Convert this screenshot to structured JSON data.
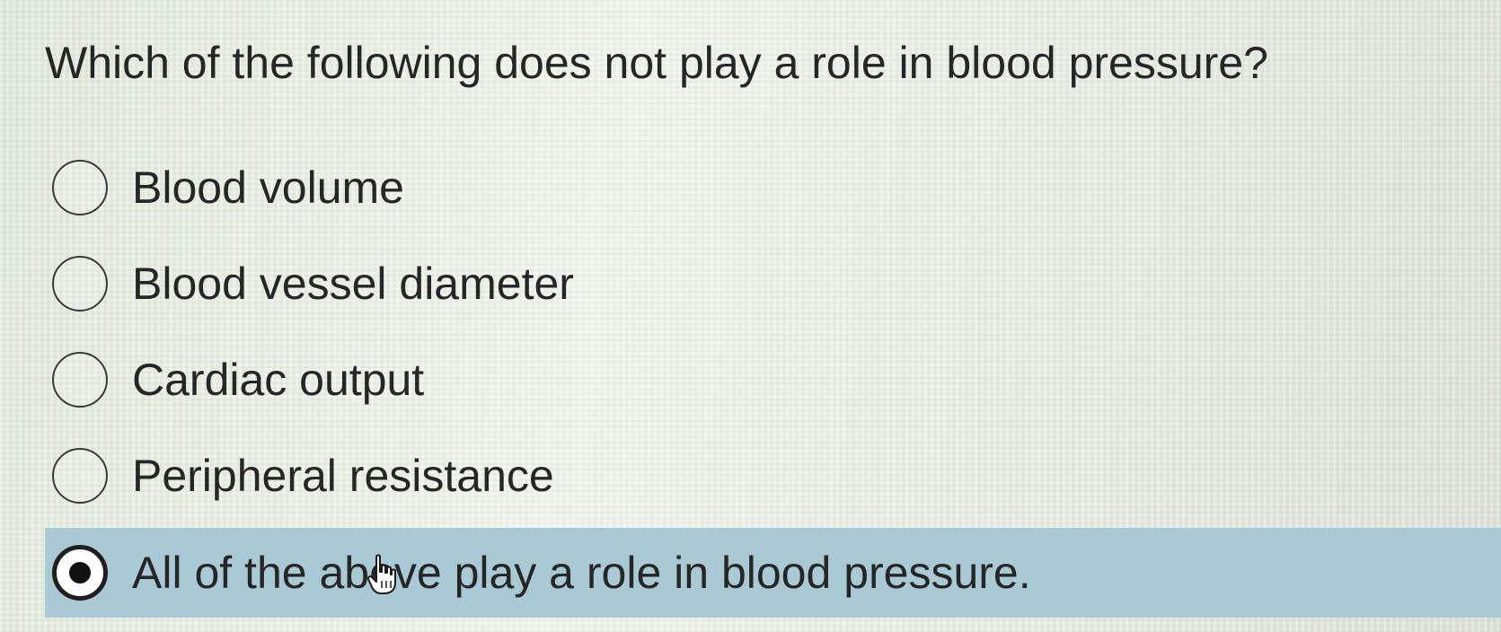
{
  "question": {
    "text": "Which of the following does not play a role in blood pressure?"
  },
  "options": [
    {
      "label": "Blood volume",
      "selected": false
    },
    {
      "label": "Blood vessel diameter",
      "selected": false
    },
    {
      "label": "Cardiac output",
      "selected": false
    },
    {
      "label": "Peripheral resistance",
      "selected": false
    },
    {
      "label": "All of the above play a role in blood pressure.",
      "selected": true
    }
  ],
  "cursor": {
    "icon": "hand-pointer-icon"
  },
  "colors": {
    "selected_row": "#a9c9d4",
    "text": "#262626"
  }
}
